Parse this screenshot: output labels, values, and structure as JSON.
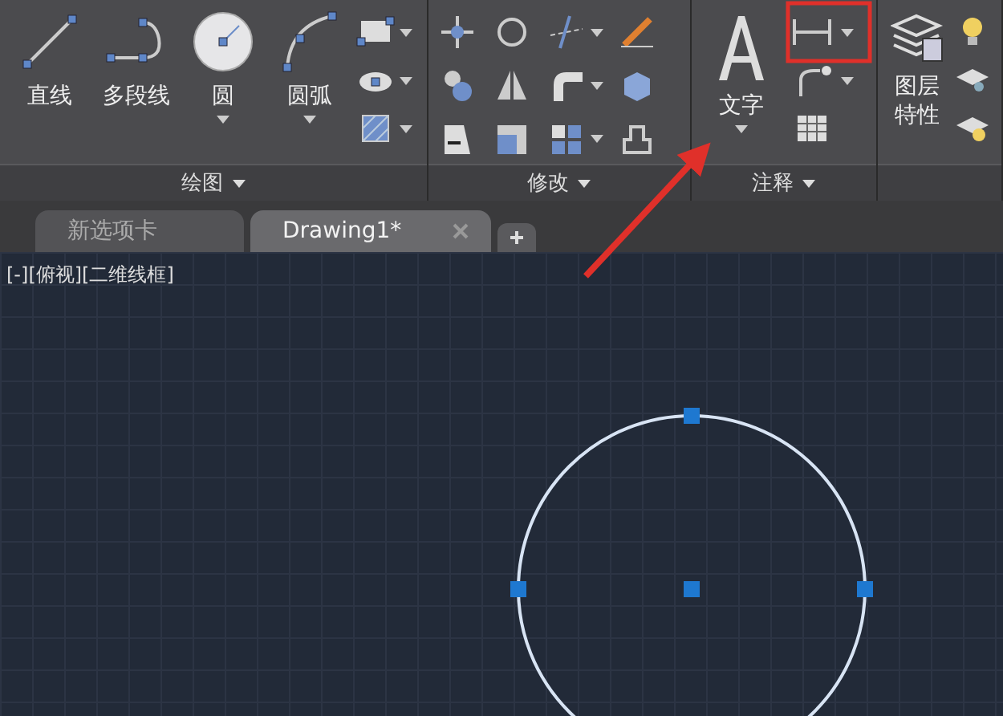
{
  "ribbon": {
    "panels": [
      {
        "kind": "draw",
        "title": "绘图",
        "tools": [
          {
            "label": "直线",
            "menu": false
          },
          {
            "label": "多段线",
            "menu": false
          },
          {
            "label": "圆",
            "menu": true
          },
          {
            "label": "圆弧",
            "menu": true
          }
        ]
      },
      {
        "kind": "modify",
        "title": "修改"
      },
      {
        "kind": "annotate",
        "title": "注释",
        "tools": [
          {
            "label": "文字",
            "menu": true
          }
        ]
      },
      {
        "kind": "layers",
        "tools": [
          {
            "label": "图层特性",
            "menu": false
          }
        ]
      }
    ]
  },
  "document_tabs": [
    {
      "label": "新选项卡",
      "selected": false
    },
    {
      "label": "Drawing1*",
      "selected": true
    }
  ],
  "viewport_label": "[-][俯视][二维线框]"
}
